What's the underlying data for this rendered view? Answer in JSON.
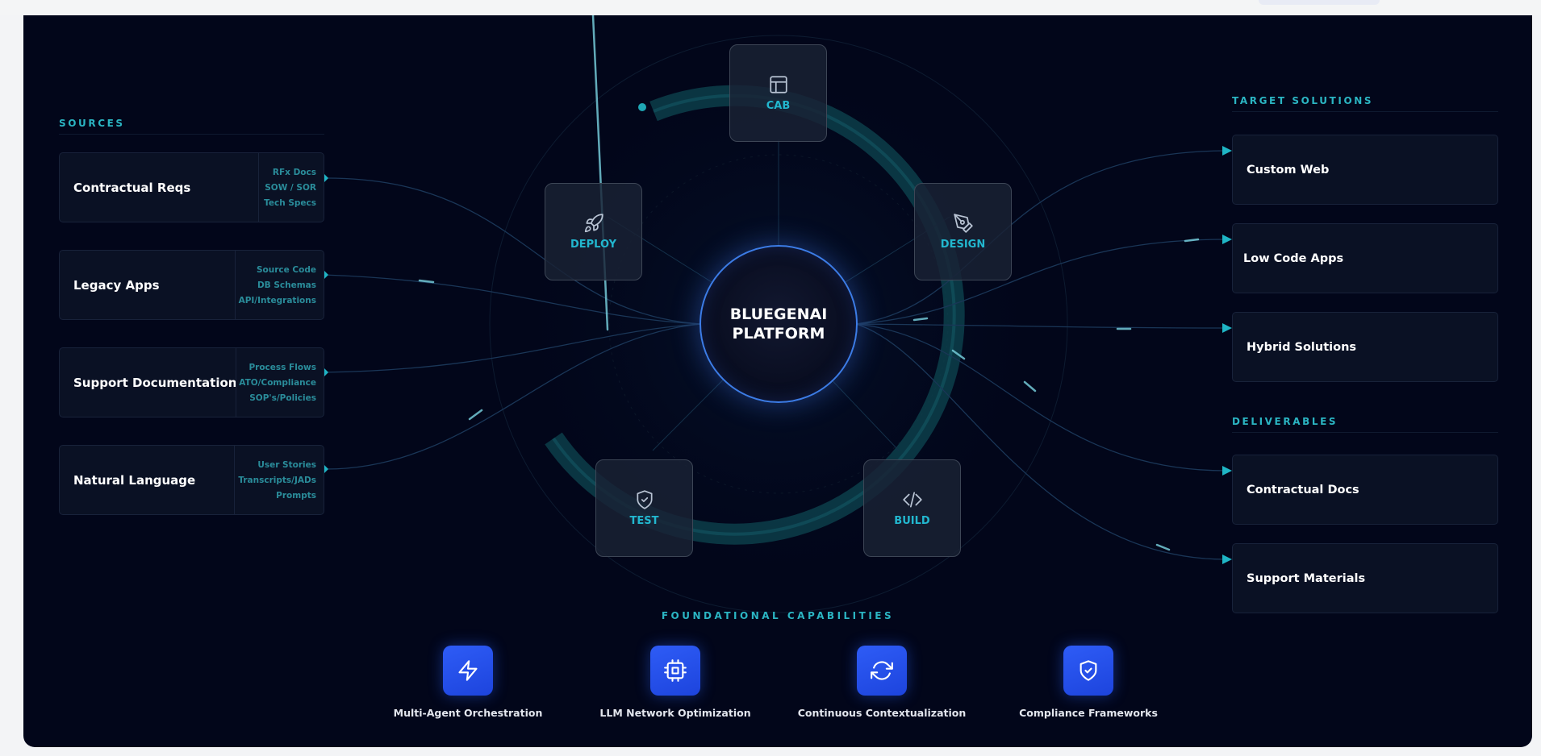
{
  "sources": {
    "heading": "SOURCES",
    "items": [
      {
        "title": "Contractual Reqs",
        "subs": [
          "RFx Docs",
          "SOW / SOR",
          "Tech Specs"
        ]
      },
      {
        "title": "Legacy Apps",
        "subs": [
          "Source Code",
          "DB Schemas",
          "API/Integrations"
        ]
      },
      {
        "title": "Support Documentation",
        "subs": [
          "Process Flows",
          "ATO/Compliance",
          "SOP's/Policies"
        ]
      },
      {
        "title": "Natural Language",
        "subs": [
          "User Stories",
          "Transcripts/JADs",
          "Prompts"
        ]
      }
    ]
  },
  "platform": {
    "hub_label": "BLUEGENAI\nPLATFORM",
    "stages": {
      "cab": {
        "label": "CAB",
        "icon": "layout-icon"
      },
      "design": {
        "label": "DESIGN",
        "icon": "pen-tool-icon"
      },
      "build": {
        "label": "BUILD",
        "icon": "code-icon"
      },
      "test": {
        "label": "TEST",
        "icon": "shield-check-icon"
      },
      "deploy": {
        "label": "DEPLOY",
        "icon": "rocket-icon"
      }
    }
  },
  "targets": {
    "heading": "TARGET SOLUTIONS",
    "items": [
      {
        "title": "Custom Web"
      },
      {
        "title": "Low Code Apps"
      },
      {
        "title": "Hybrid Solutions"
      }
    ]
  },
  "deliverables": {
    "heading": "DELIVERABLES",
    "items": [
      {
        "title": "Contractual Docs"
      },
      {
        "title": "Support Materials"
      }
    ]
  },
  "capabilities": {
    "heading": "FOUNDATIONAL CAPABILITIES",
    "items": [
      {
        "label": "Multi-Agent Orchestration",
        "icon": "lightning-icon"
      },
      {
        "label": "LLM Network Optimization",
        "icon": "cpu-icon"
      },
      {
        "label": "Continuous Contextualization",
        "icon": "refresh-icon"
      },
      {
        "label": "Compliance Frameworks",
        "icon": "shield-check-icon"
      }
    ]
  },
  "colors": {
    "panel_bg": "#02061a",
    "accent_cyan": "#22b7cf",
    "hub_ring": "#3c7ce6",
    "capability_blue": "#2552ef"
  }
}
